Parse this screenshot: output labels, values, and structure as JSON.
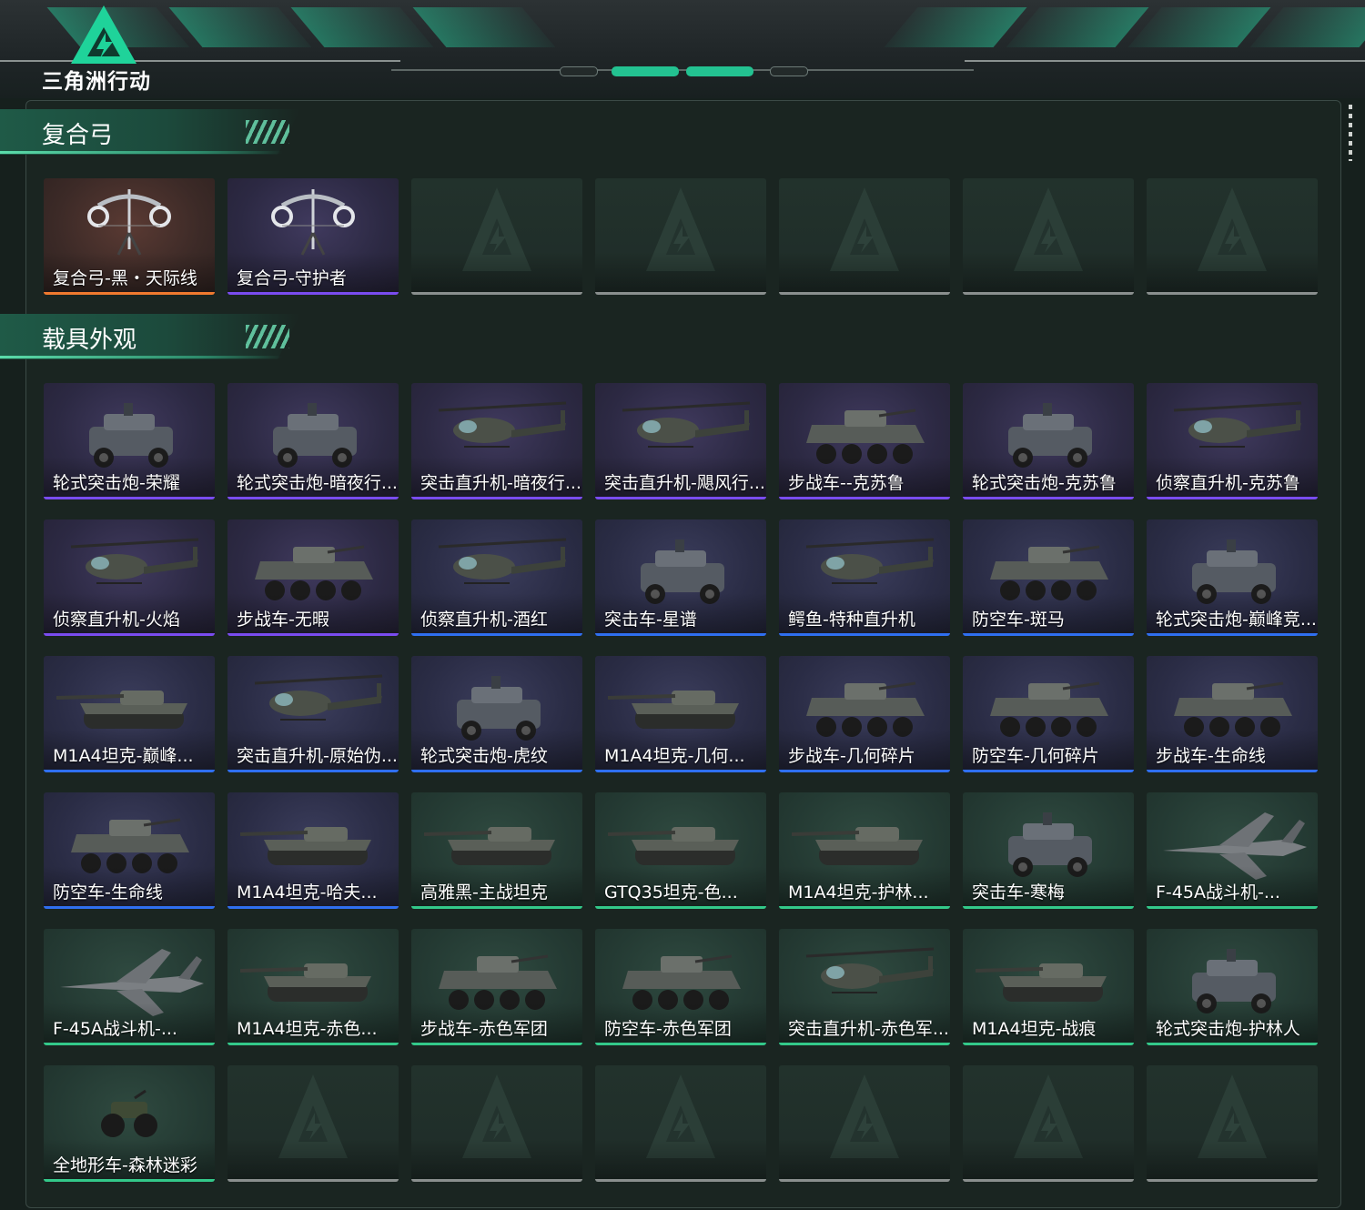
{
  "app": {
    "title": "三角洲行动"
  },
  "sections": [
    {
      "title": "复合弓",
      "items": [
        {
          "name": "复合弓-黑・天际线",
          "rarity": "orange",
          "icon": "compound-bow-icon"
        },
        {
          "name": "复合弓-守护者",
          "rarity": "purple",
          "icon": "compound-bow-icon"
        },
        {
          "name": "",
          "rarity": "empty",
          "icon": "delta-logo-placeholder-icon"
        },
        {
          "name": "",
          "rarity": "empty",
          "icon": "delta-logo-placeholder-icon"
        },
        {
          "name": "",
          "rarity": "empty",
          "icon": "delta-logo-placeholder-icon"
        },
        {
          "name": "",
          "rarity": "empty",
          "icon": "delta-logo-placeholder-icon"
        },
        {
          "name": "",
          "rarity": "empty",
          "icon": "delta-logo-placeholder-icon"
        }
      ]
    },
    {
      "title": "载具外观",
      "items": [
        {
          "name": "轮式突击炮-荣耀",
          "rarity": "purple",
          "icon": "armored-car-icon"
        },
        {
          "name": "轮式突击炮-暗夜行...",
          "rarity": "purple",
          "icon": "armored-car-icon"
        },
        {
          "name": "突击直升机-暗夜行...",
          "rarity": "purple",
          "icon": "helicopter-icon"
        },
        {
          "name": "突击直升机-飓风行...",
          "rarity": "purple",
          "icon": "helicopter-icon"
        },
        {
          "name": "步战车--克苏鲁",
          "rarity": "purple",
          "icon": "ifv-icon"
        },
        {
          "name": "轮式突击炮-克苏鲁",
          "rarity": "purple",
          "icon": "armored-car-icon"
        },
        {
          "name": "侦察直升机-克苏鲁",
          "rarity": "purple",
          "icon": "helicopter-icon"
        },
        {
          "name": "侦察直升机-火焰",
          "rarity": "purple",
          "icon": "helicopter-icon"
        },
        {
          "name": "步战车-无暇",
          "rarity": "purple",
          "icon": "ifv-icon"
        },
        {
          "name": "侦察直升机-酒红",
          "rarity": "blue",
          "icon": "helicopter-icon"
        },
        {
          "name": "突击车-星谱",
          "rarity": "blue",
          "icon": "armored-car-icon"
        },
        {
          "name": "鳄鱼-特种直升机",
          "rarity": "blue",
          "icon": "helicopter-icon"
        },
        {
          "name": "防空车-斑马",
          "rarity": "blue",
          "icon": "ifv-icon"
        },
        {
          "name": "轮式突击炮-巅峰竞...",
          "rarity": "blue",
          "icon": "armored-car-icon"
        },
        {
          "name": "M1A4坦克-巅峰...",
          "rarity": "blue",
          "icon": "tank-icon"
        },
        {
          "name": "突击直升机-原始伪...",
          "rarity": "blue",
          "icon": "helicopter-icon"
        },
        {
          "name": "轮式突击炮-虎纹",
          "rarity": "blue",
          "icon": "armored-car-icon"
        },
        {
          "name": "M1A4坦克-几何...",
          "rarity": "blue",
          "icon": "tank-icon"
        },
        {
          "name": "步战车-几何碎片",
          "rarity": "blue",
          "icon": "ifv-icon"
        },
        {
          "name": "防空车-几何碎片",
          "rarity": "blue",
          "icon": "ifv-icon"
        },
        {
          "name": "步战车-生命线",
          "rarity": "blue",
          "icon": "ifv-icon"
        },
        {
          "name": "防空车-生命线",
          "rarity": "blue",
          "icon": "ifv-icon"
        },
        {
          "name": "M1A4坦克-哈夫...",
          "rarity": "blue",
          "icon": "tank-icon"
        },
        {
          "name": "高雅黑-主战坦克",
          "rarity": "green",
          "icon": "tank-icon"
        },
        {
          "name": "GTQ35坦克-色...",
          "rarity": "green",
          "icon": "tank-icon"
        },
        {
          "name": "M1A4坦克-护林...",
          "rarity": "green",
          "icon": "tank-icon"
        },
        {
          "name": "突击车-寒梅",
          "rarity": "green",
          "icon": "armored-car-icon"
        },
        {
          "name": "F-45A战斗机-...",
          "rarity": "green",
          "icon": "fighter-jet-icon"
        },
        {
          "name": "F-45A战斗机-...",
          "rarity": "green",
          "icon": "fighter-jet-icon"
        },
        {
          "name": "M1A4坦克-赤色...",
          "rarity": "green",
          "icon": "tank-icon"
        },
        {
          "name": "步战车-赤色军团",
          "rarity": "green",
          "icon": "ifv-icon"
        },
        {
          "name": "防空车-赤色军团",
          "rarity": "green",
          "icon": "ifv-icon"
        },
        {
          "name": "突击直升机-赤色军...",
          "rarity": "green",
          "icon": "helicopter-icon"
        },
        {
          "name": "M1A4坦克-战痕",
          "rarity": "green",
          "icon": "tank-icon"
        },
        {
          "name": "轮式突击炮-护林人",
          "rarity": "green",
          "icon": "armored-car-icon"
        },
        {
          "name": "全地形车-森林迷彩",
          "rarity": "green",
          "icon": "atv-icon"
        },
        {
          "name": "",
          "rarity": "empty",
          "icon": "delta-logo-placeholder-icon"
        },
        {
          "name": "",
          "rarity": "empty",
          "icon": "delta-logo-placeholder-icon"
        },
        {
          "name": "",
          "rarity": "empty",
          "icon": "delta-logo-placeholder-icon"
        },
        {
          "name": "",
          "rarity": "empty",
          "icon": "delta-logo-placeholder-icon"
        },
        {
          "name": "",
          "rarity": "empty",
          "icon": "delta-logo-placeholder-icon"
        },
        {
          "name": "",
          "rarity": "empty",
          "icon": "delta-logo-placeholder-icon"
        }
      ]
    }
  ],
  "colors": {
    "accent": "#23c291",
    "rarity_orange": "#f07a2f",
    "rarity_purple": "#7a4cf0",
    "rarity_blue": "#2f6ff0",
    "rarity_green": "#33c98a",
    "rarity_empty": "#8a8f8e"
  }
}
